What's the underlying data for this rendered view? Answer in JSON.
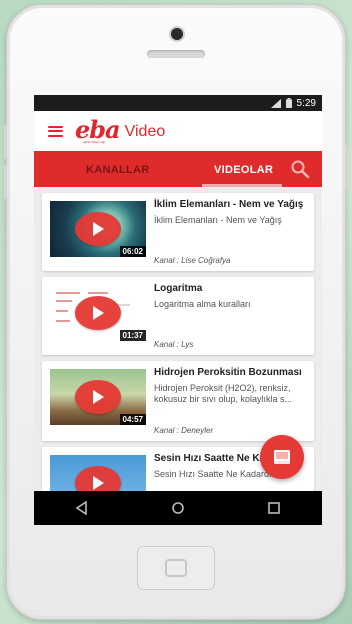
{
  "status_bar": {
    "time": "5:29",
    "icons": [
      "signal-icon",
      "battery-icon"
    ]
  },
  "app_bar": {
    "menu_icon": "hamburger-menu-icon",
    "logo_text": "eba",
    "logo_tagline": "eğitim bilişim ağı",
    "title": "Video"
  },
  "tabs": {
    "channels_label": "KANALLAR",
    "videos_label": "VIDEOLAR",
    "active": "VIDEOLAR",
    "search_icon": "search-icon"
  },
  "videos": [
    {
      "title": "İklim Elemanları - Nem ve Yağış",
      "description": "İklim Elemanları - Nem ve Yağış",
      "channel": "Kanal : Lise Coğrafya",
      "duration": "06:02"
    },
    {
      "title": "Logaritma",
      "description": "Logaritma alma kuralları",
      "channel": "Kanal : Lys",
      "duration": "01:37"
    },
    {
      "title": "Hidrojen Peroksitin Bozunması",
      "description": "Hidrojen Peroksit (H2O2), renksiz, kokusuz bir sıvı olup, kolaylıkla s...",
      "channel": "Kanal : Deneyler",
      "duration": "04:57"
    },
    {
      "title": "Sesin Hızı Saatte Ne Kadardır?",
      "description": "Sesin Hızı Saatte Ne Kadardır?",
      "channel": "",
      "duration": ""
    }
  ],
  "fab_icon": "book-icon",
  "colors": {
    "brand_red": "#e1262d",
    "tab_bar": "#df2b2b",
    "inactive_tab": "#7a1515",
    "play_button": "#e53935"
  },
  "nav_icons": [
    "back-icon",
    "home-icon",
    "recents-icon"
  ]
}
